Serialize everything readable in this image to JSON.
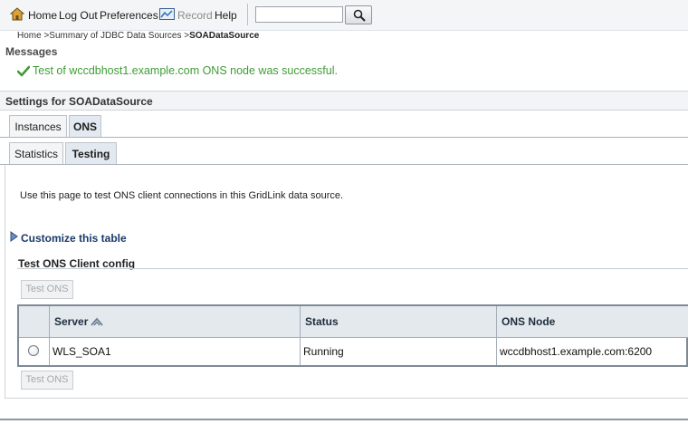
{
  "toolbar": {
    "home_label": "Home",
    "logout_label": "Log Out",
    "preferences_label": "Preferences",
    "record_label": "Record",
    "help_label": "Help",
    "search_value": "",
    "search_placeholder": ""
  },
  "breadcrumb": {
    "home": "Home >",
    "summary": "Summary of JDBC Data Sources >",
    "current": "SOADataSource"
  },
  "messages": {
    "title": "Messages",
    "success_text": "Test of wccdbhost1.example.com ONS node was successful.",
    "success_color": "#3f9c35"
  },
  "settings": {
    "title": "Settings for SOADataSource"
  },
  "tabs": {
    "primary": [
      {
        "label": "Instances"
      },
      {
        "label": "ONS"
      }
    ],
    "secondary": [
      {
        "label": "Statistics"
      },
      {
        "label": "Testing"
      }
    ]
  },
  "content": {
    "intro": "Use this page to test ONS client connections in this GridLink data source.",
    "customize_link": "Customize this table",
    "table_title": "Test ONS Client config",
    "test_button": "Test ONS"
  },
  "table": {
    "columns": [
      "Server",
      "Status",
      "ONS Node"
    ],
    "rows": [
      {
        "server": "WLS_SOA1",
        "status": "Running",
        "ons_node": "wccdbhost1.example.com:6200",
        "selected": false
      }
    ]
  }
}
